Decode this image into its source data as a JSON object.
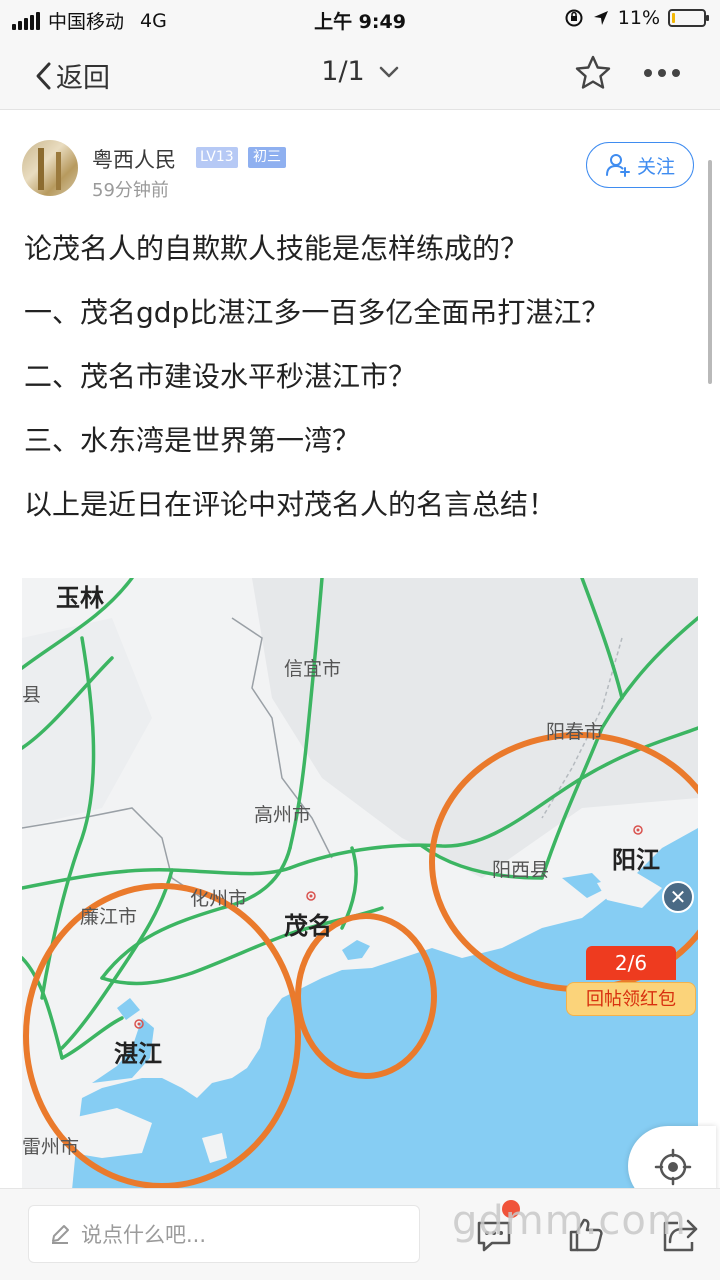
{
  "status_bar": {
    "carrier": "中国移动",
    "network": "4G",
    "time": "上午 9:49",
    "battery_percent": "11%",
    "battery_level": 0.11
  },
  "nav": {
    "back_label": "返回",
    "page_indicator": "1/1"
  },
  "author": {
    "name": "粤西人民",
    "level": "LV13",
    "grade": "初三",
    "time_ago": "59分钟前",
    "follow_label": "关注"
  },
  "post": {
    "lines": [
      "论茂名人的自欺欺人技能是怎样练成的？",
      "一、茂名gdp比湛江多一百多亿全面吊打湛江？",
      "二、茂名市建设水平秒湛江市？",
      "三、水东湾是世界第一湾？",
      "以上是近日在评论中对茂名人的名言总结！"
    ]
  },
  "map": {
    "labels": {
      "yulin": "玉林",
      "xian": "县",
      "xinyi": "信宜市",
      "yangchun": "阳春市",
      "gaozhou": "高州市",
      "yangxi": "阳西县",
      "yangjiang": "阳江",
      "huazhou": "化州市",
      "lianjiang": "廉江市",
      "maoming": "茂名",
      "zhanjiang": "湛江",
      "leizhou": "雷州市"
    },
    "close_symbol": "✕"
  },
  "redpack": {
    "count": "2/6",
    "label": "回帖领红包"
  },
  "bottom": {
    "comment_placeholder": "说点什么吧...",
    "watermark": "gdmm.com"
  },
  "colors": {
    "accent_blue": "#3f8cf0",
    "road_green": "#3cb562",
    "sea": "#86cdf3",
    "circle_orange": "#ea7a2c"
  }
}
